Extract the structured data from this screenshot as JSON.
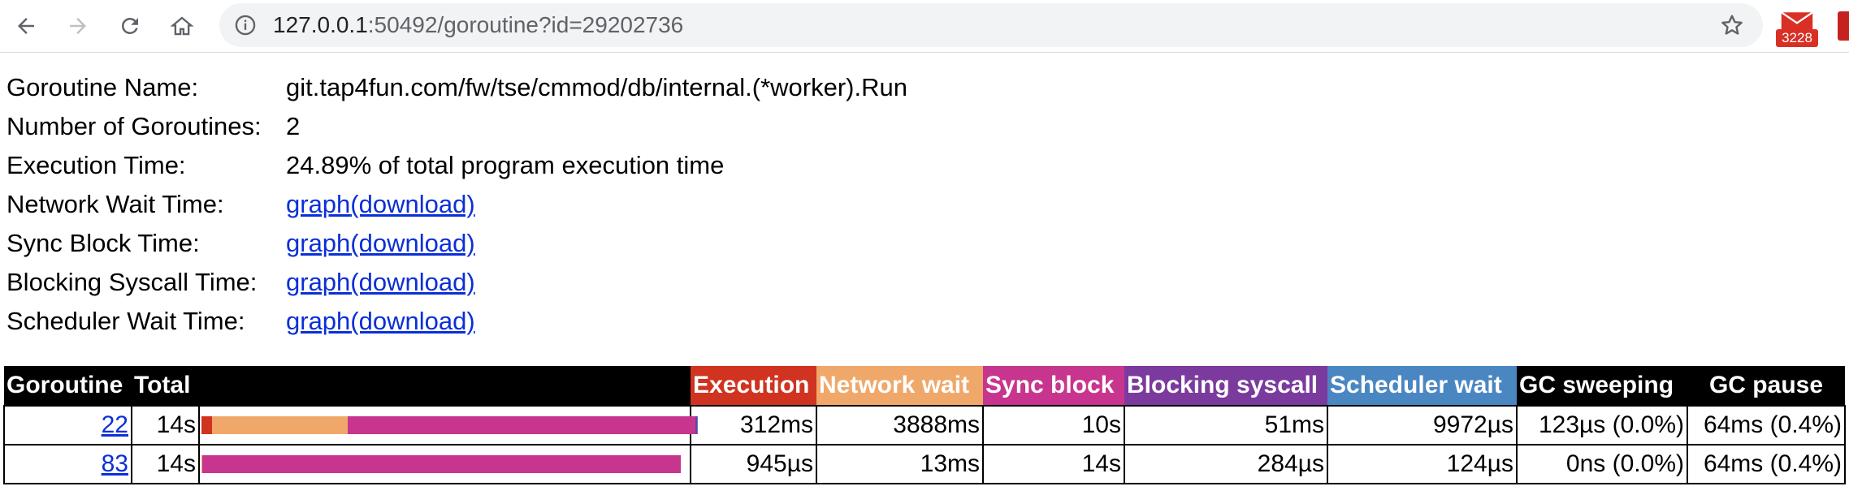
{
  "browser": {
    "url_host": "127.0.0.1",
    "url_rest": ":50492/goroutine?id=29202736",
    "mail_badge": "3228"
  },
  "info": [
    {
      "key": "Goroutine Name:",
      "value": "git.tap4fun.com/fw/tse/cmmod/db/internal.(*worker).Run",
      "link": false
    },
    {
      "key": "Number of Goroutines:",
      "value": "2",
      "link": false
    },
    {
      "key": "Execution Time:",
      "value": "24.89% of total program execution time",
      "link": false
    },
    {
      "key": "Network Wait Time:",
      "graph": "graph",
      "download": "(download)",
      "link": true
    },
    {
      "key": "Sync Block Time:",
      "graph": "graph",
      "download": "(download)",
      "link": true
    },
    {
      "key": "Blocking Syscall Time:",
      "graph": "graph",
      "download": "(download)",
      "link": true
    },
    {
      "key": "Scheduler Wait Time:",
      "graph": "graph",
      "download": "(download)",
      "link": true
    }
  ],
  "stats": {
    "headers": {
      "goroutine": "Goroutine",
      "total": "Total",
      "execution": "Execution",
      "network_wait": "Network wait",
      "sync_block": "Sync block",
      "blocking_syscall": "Blocking syscall",
      "scheduler_wait": "Scheduler wait",
      "gc_sweeping": "GC sweeping",
      "gc_pause": "GC pause"
    },
    "colors": {
      "header_bg": "#000000",
      "execution": "#d0331f",
      "network_wait": "#f0a86a",
      "sync_block": "#c8358e",
      "blocking_syscall": "#7b3a9e",
      "scheduler_wait": "#4a86c2"
    },
    "rows": [
      {
        "id": "22",
        "total": "14s",
        "execution": "312ms",
        "network_wait": "3888ms",
        "sync_block": "10s",
        "blocking_syscall": "51ms",
        "scheduler_wait": "9972µs",
        "gc_sweeping": "123µs (0.0%)",
        "gc_pause": "64ms (0.4%)",
        "bar": [
          {
            "kind": "execution",
            "fraction": 0.0223
          },
          {
            "kind": "network_wait",
            "fraction": 0.2777
          },
          {
            "kind": "sync_block",
            "fraction": 0.7143
          },
          {
            "kind": "blocking_syscall",
            "fraction": 0.0036
          },
          {
            "kind": "scheduler_wait",
            "fraction": 0.0007
          }
        ]
      },
      {
        "id": "83",
        "total": "14s",
        "execution": "945µs",
        "network_wait": "13ms",
        "sync_block": "14s",
        "blocking_syscall": "284µs",
        "scheduler_wait": "124µs",
        "gc_sweeping": "0ns (0.0%)",
        "gc_pause": "64ms (0.4%)",
        "bar": [
          {
            "kind": "execution",
            "fraction": 0.0001
          },
          {
            "kind": "network_wait",
            "fraction": 0.0009
          },
          {
            "kind": "sync_block",
            "fraction": 0.984
          },
          {
            "kind": "blocking_syscall",
            "fraction": 0.0
          },
          {
            "kind": "scheduler_wait",
            "fraction": 0.0
          }
        ]
      }
    ]
  }
}
